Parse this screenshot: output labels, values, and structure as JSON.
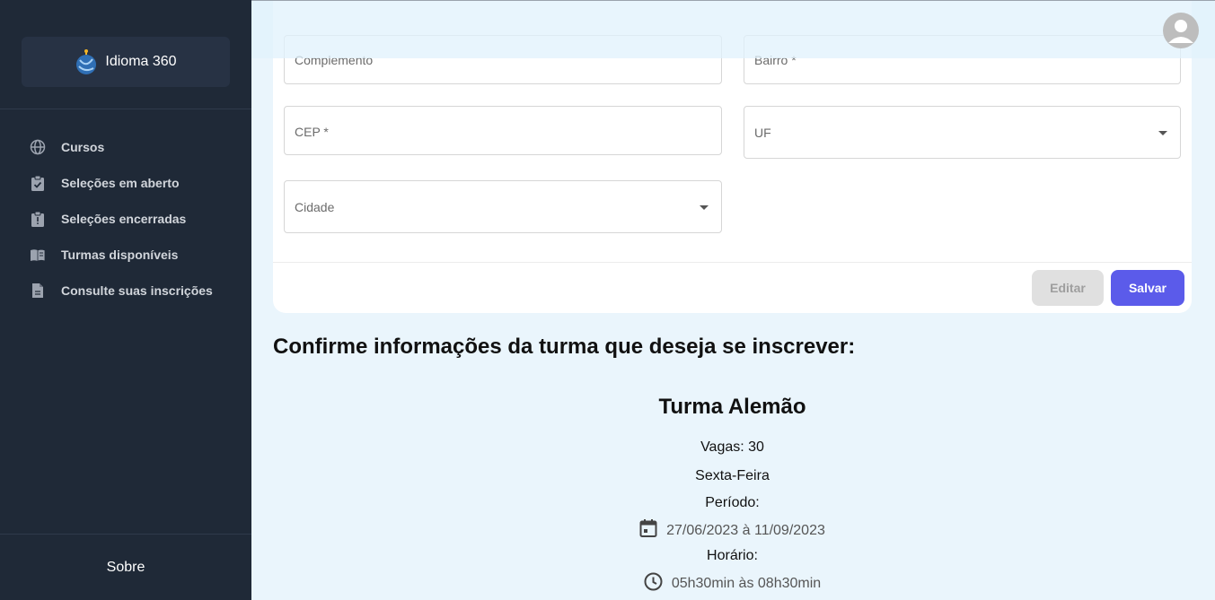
{
  "brand": {
    "name": "Idioma 360"
  },
  "sidebar": {
    "items": [
      {
        "label": "Cursos",
        "icon": "globe-icon"
      },
      {
        "label": "Seleções em aberto",
        "icon": "clipboard-check-icon"
      },
      {
        "label": "Seleções encerradas",
        "icon": "clipboard-alert-icon"
      },
      {
        "label": "Turmas disponíveis",
        "icon": "book-open-icon"
      },
      {
        "label": "Consulte suas inscrições",
        "icon": "document-icon"
      }
    ],
    "footer_label": "Sobre"
  },
  "form": {
    "complemento_placeholder": "Complemento",
    "bairro_placeholder": "Bairro *",
    "cep_placeholder": "CEP *",
    "uf_placeholder": "UF",
    "cidade_placeholder": "Cidade",
    "edit_label": "Editar",
    "save_label": "Salvar"
  },
  "confirm": {
    "heading": "Confirme informações da turma que deseja se inscrever:",
    "class_title": "Turma Alemão",
    "vagas": "Vagas: 30",
    "weekday": "Sexta-Feira",
    "period_label": "Período:",
    "period_value": "27/06/2023 à 11/09/2023",
    "time_label": "Horário:",
    "time_value": "05h30min às 08h30min"
  },
  "colors": {
    "sidebar_bg": "#1f2937",
    "accent": "#5b5bea",
    "page_bg": "#eaf5fc"
  }
}
